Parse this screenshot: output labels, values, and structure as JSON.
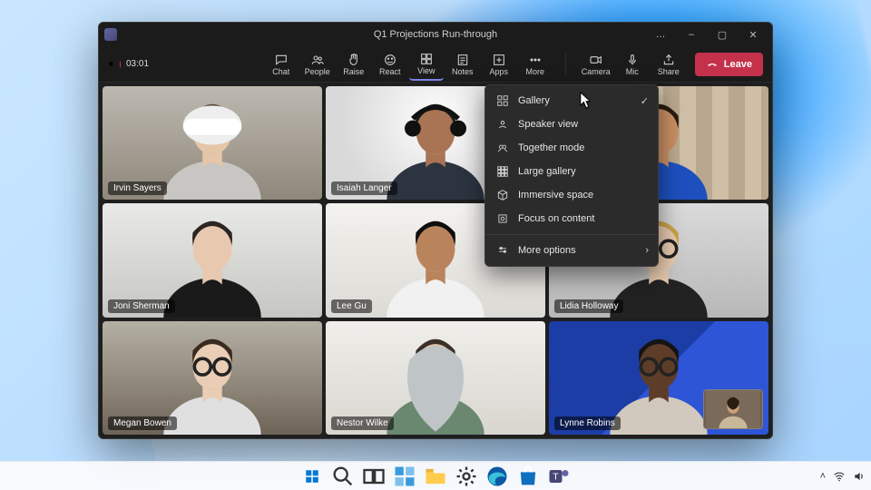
{
  "window": {
    "title": "Q1 Projections Run-through",
    "more_label": "…",
    "min_label": "–",
    "max_label": "▢",
    "close_label": "✕"
  },
  "toolbar": {
    "shield_label": "",
    "timer": "03:01",
    "buttons": {
      "chat": "Chat",
      "people": "People",
      "raise": "Raise",
      "react": "React",
      "view": "View",
      "notes": "Notes",
      "apps": "Apps",
      "more": "More",
      "camera": "Camera",
      "mic": "Mic",
      "share": "Share"
    },
    "leave": "Leave"
  },
  "view_menu": {
    "items": [
      {
        "label": "Gallery",
        "icon": "grid",
        "selected": true
      },
      {
        "label": "Speaker view",
        "icon": "speaker"
      },
      {
        "label": "Together mode",
        "icon": "together"
      },
      {
        "label": "Large gallery",
        "icon": "large-grid"
      },
      {
        "label": "Immersive space",
        "icon": "cube"
      },
      {
        "label": "Focus on content",
        "icon": "focus"
      }
    ],
    "more": "More options"
  },
  "participants": [
    {
      "name": "Irvin Sayers",
      "skin": "#e6c6a8",
      "shirt": "#c8c6c2",
      "hair": "#5a4a3a",
      "bg": "bg1",
      "headset": true
    },
    {
      "name": "Isaiah Langer",
      "skin": "#a87454",
      "shirt": "#2c3440",
      "hair": "#1d1d1d",
      "bg": "bg2",
      "headphones": true
    },
    {
      "name": "",
      "skin": "#c98f64",
      "shirt": "#1d4fbf",
      "hair": "#2a1a10",
      "bg": "bg3"
    },
    {
      "name": "Joni Sherman",
      "skin": "#e8c9b0",
      "shirt": "#1a1a1a",
      "hair": "#2b2622",
      "bg": "bg4"
    },
    {
      "name": "Lee Gu",
      "skin": "#b9845c",
      "shirt": "#f1f1f1",
      "hair": "#0d0d0d",
      "bg": "bg5"
    },
    {
      "name": "Lidia Holloway",
      "skin": "#e7caae",
      "shirt": "#222",
      "hair": "#c9a24a",
      "bg": "bg6",
      "glasses": true
    },
    {
      "name": "Megan Bowen",
      "skin": "#e9cdb5",
      "shirt": "#e0e0e0",
      "hair": "#3a2a1f",
      "bg": "bg7",
      "glasses": true
    },
    {
      "name": "Nestor Wilke",
      "skin": "#e3c3a4",
      "shirt": "#6a8770",
      "hair": "#3b3027",
      "bg": "bg8",
      "hijab": "#bfc4c6"
    },
    {
      "name": "Lynne Robins",
      "skin": "#5e3d28",
      "shirt": "#d1c9bd",
      "hair": "#141414",
      "bg": "bg9",
      "glasses": true,
      "pip": true
    }
  ],
  "taskbar": {
    "items": [
      "start",
      "search",
      "task-view",
      "widgets",
      "explorer",
      "settings",
      "edge",
      "store",
      "teams"
    ]
  },
  "icons": {
    "shield": "shield-icon"
  }
}
